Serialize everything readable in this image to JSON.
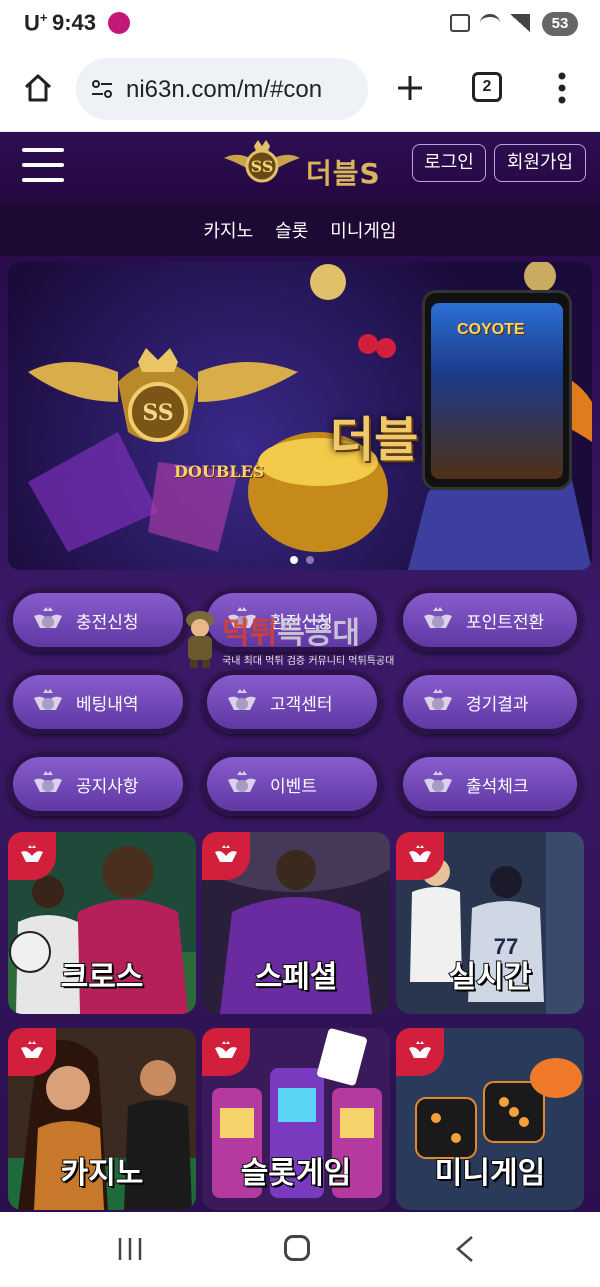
{
  "status_bar": {
    "carrier": "U",
    "carrier_sup": "+",
    "time": "9:43",
    "battery": "53",
    "icons": [
      "mute-icon",
      "wifi-icon",
      "signal-icon"
    ]
  },
  "browser": {
    "url": "ni63n.com/m/#con",
    "tab_count": "2"
  },
  "header": {
    "logo_text": "더블S",
    "login": "로그인",
    "signup": "회원가입"
  },
  "sub_nav": [
    "카지노",
    "슬롯",
    "미니게임"
  ],
  "banner": {
    "title": "더블S",
    "emblem_text": "DOUBLES",
    "phone_game": "COYOTE"
  },
  "menu": [
    "충전신청",
    "환전신청",
    "포인트전환",
    "베팅내역",
    "고객센터",
    "경기결과",
    "공지사항",
    "이벤트",
    "출석체크"
  ],
  "watermark": {
    "title_red": "먹튀",
    "title_rest": "특공대",
    "subtitle": "국내 최대 먹튀 검증 커뮤니티 먹튀특공대"
  },
  "cards": [
    "크로스",
    "스페셜",
    "실시간",
    "카지노",
    "슬롯게임",
    "미니게임"
  ],
  "colors": {
    "header_bg": "#2e0f55",
    "body_bg": "#3b1a68",
    "accent_gold": "#d8b45a",
    "badge_red": "#d21f3c",
    "button_purple": "#8c5fd0"
  }
}
